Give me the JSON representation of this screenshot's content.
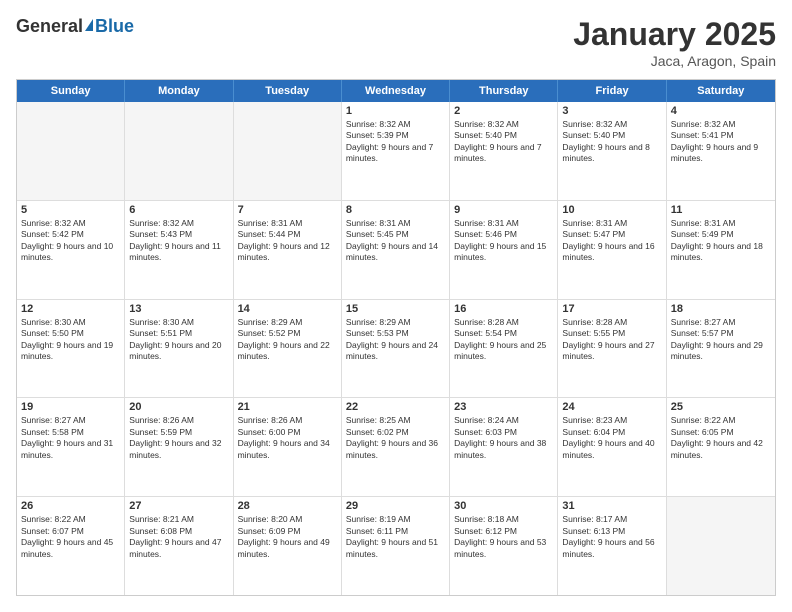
{
  "logo": {
    "general": "General",
    "blue": "Blue",
    "tagline": ""
  },
  "header": {
    "title": "January 2025",
    "location": "Jaca, Aragon, Spain"
  },
  "weekdays": [
    "Sunday",
    "Monday",
    "Tuesday",
    "Wednesday",
    "Thursday",
    "Friday",
    "Saturday"
  ],
  "rows": [
    [
      {
        "day": "",
        "sunrise": "",
        "sunset": "",
        "daylight": ""
      },
      {
        "day": "",
        "sunrise": "",
        "sunset": "",
        "daylight": ""
      },
      {
        "day": "",
        "sunrise": "",
        "sunset": "",
        "daylight": ""
      },
      {
        "day": "1",
        "sunrise": "Sunrise: 8:32 AM",
        "sunset": "Sunset: 5:39 PM",
        "daylight": "Daylight: 9 hours and 7 minutes."
      },
      {
        "day": "2",
        "sunrise": "Sunrise: 8:32 AM",
        "sunset": "Sunset: 5:40 PM",
        "daylight": "Daylight: 9 hours and 7 minutes."
      },
      {
        "day": "3",
        "sunrise": "Sunrise: 8:32 AM",
        "sunset": "Sunset: 5:40 PM",
        "daylight": "Daylight: 9 hours and 8 minutes."
      },
      {
        "day": "4",
        "sunrise": "Sunrise: 8:32 AM",
        "sunset": "Sunset: 5:41 PM",
        "daylight": "Daylight: 9 hours and 9 minutes."
      }
    ],
    [
      {
        "day": "5",
        "sunrise": "Sunrise: 8:32 AM",
        "sunset": "Sunset: 5:42 PM",
        "daylight": "Daylight: 9 hours and 10 minutes."
      },
      {
        "day": "6",
        "sunrise": "Sunrise: 8:32 AM",
        "sunset": "Sunset: 5:43 PM",
        "daylight": "Daylight: 9 hours and 11 minutes."
      },
      {
        "day": "7",
        "sunrise": "Sunrise: 8:31 AM",
        "sunset": "Sunset: 5:44 PM",
        "daylight": "Daylight: 9 hours and 12 minutes."
      },
      {
        "day": "8",
        "sunrise": "Sunrise: 8:31 AM",
        "sunset": "Sunset: 5:45 PM",
        "daylight": "Daylight: 9 hours and 14 minutes."
      },
      {
        "day": "9",
        "sunrise": "Sunrise: 8:31 AM",
        "sunset": "Sunset: 5:46 PM",
        "daylight": "Daylight: 9 hours and 15 minutes."
      },
      {
        "day": "10",
        "sunrise": "Sunrise: 8:31 AM",
        "sunset": "Sunset: 5:47 PM",
        "daylight": "Daylight: 9 hours and 16 minutes."
      },
      {
        "day": "11",
        "sunrise": "Sunrise: 8:31 AM",
        "sunset": "Sunset: 5:49 PM",
        "daylight": "Daylight: 9 hours and 18 minutes."
      }
    ],
    [
      {
        "day": "12",
        "sunrise": "Sunrise: 8:30 AM",
        "sunset": "Sunset: 5:50 PM",
        "daylight": "Daylight: 9 hours and 19 minutes."
      },
      {
        "day": "13",
        "sunrise": "Sunrise: 8:30 AM",
        "sunset": "Sunset: 5:51 PM",
        "daylight": "Daylight: 9 hours and 20 minutes."
      },
      {
        "day": "14",
        "sunrise": "Sunrise: 8:29 AM",
        "sunset": "Sunset: 5:52 PM",
        "daylight": "Daylight: 9 hours and 22 minutes."
      },
      {
        "day": "15",
        "sunrise": "Sunrise: 8:29 AM",
        "sunset": "Sunset: 5:53 PM",
        "daylight": "Daylight: 9 hours and 24 minutes."
      },
      {
        "day": "16",
        "sunrise": "Sunrise: 8:28 AM",
        "sunset": "Sunset: 5:54 PM",
        "daylight": "Daylight: 9 hours and 25 minutes."
      },
      {
        "day": "17",
        "sunrise": "Sunrise: 8:28 AM",
        "sunset": "Sunset: 5:55 PM",
        "daylight": "Daylight: 9 hours and 27 minutes."
      },
      {
        "day": "18",
        "sunrise": "Sunrise: 8:27 AM",
        "sunset": "Sunset: 5:57 PM",
        "daylight": "Daylight: 9 hours and 29 minutes."
      }
    ],
    [
      {
        "day": "19",
        "sunrise": "Sunrise: 8:27 AM",
        "sunset": "Sunset: 5:58 PM",
        "daylight": "Daylight: 9 hours and 31 minutes."
      },
      {
        "day": "20",
        "sunrise": "Sunrise: 8:26 AM",
        "sunset": "Sunset: 5:59 PM",
        "daylight": "Daylight: 9 hours and 32 minutes."
      },
      {
        "day": "21",
        "sunrise": "Sunrise: 8:26 AM",
        "sunset": "Sunset: 6:00 PM",
        "daylight": "Daylight: 9 hours and 34 minutes."
      },
      {
        "day": "22",
        "sunrise": "Sunrise: 8:25 AM",
        "sunset": "Sunset: 6:02 PM",
        "daylight": "Daylight: 9 hours and 36 minutes."
      },
      {
        "day": "23",
        "sunrise": "Sunrise: 8:24 AM",
        "sunset": "Sunset: 6:03 PM",
        "daylight": "Daylight: 9 hours and 38 minutes."
      },
      {
        "day": "24",
        "sunrise": "Sunrise: 8:23 AM",
        "sunset": "Sunset: 6:04 PM",
        "daylight": "Daylight: 9 hours and 40 minutes."
      },
      {
        "day": "25",
        "sunrise": "Sunrise: 8:22 AM",
        "sunset": "Sunset: 6:05 PM",
        "daylight": "Daylight: 9 hours and 42 minutes."
      }
    ],
    [
      {
        "day": "26",
        "sunrise": "Sunrise: 8:22 AM",
        "sunset": "Sunset: 6:07 PM",
        "daylight": "Daylight: 9 hours and 45 minutes."
      },
      {
        "day": "27",
        "sunrise": "Sunrise: 8:21 AM",
        "sunset": "Sunset: 6:08 PM",
        "daylight": "Daylight: 9 hours and 47 minutes."
      },
      {
        "day": "28",
        "sunrise": "Sunrise: 8:20 AM",
        "sunset": "Sunset: 6:09 PM",
        "daylight": "Daylight: 9 hours and 49 minutes."
      },
      {
        "day": "29",
        "sunrise": "Sunrise: 8:19 AM",
        "sunset": "Sunset: 6:11 PM",
        "daylight": "Daylight: 9 hours and 51 minutes."
      },
      {
        "day": "30",
        "sunrise": "Sunrise: 8:18 AM",
        "sunset": "Sunset: 6:12 PM",
        "daylight": "Daylight: 9 hours and 53 minutes."
      },
      {
        "day": "31",
        "sunrise": "Sunrise: 8:17 AM",
        "sunset": "Sunset: 6:13 PM",
        "daylight": "Daylight: 9 hours and 56 minutes."
      },
      {
        "day": "",
        "sunrise": "",
        "sunset": "",
        "daylight": ""
      }
    ]
  ]
}
